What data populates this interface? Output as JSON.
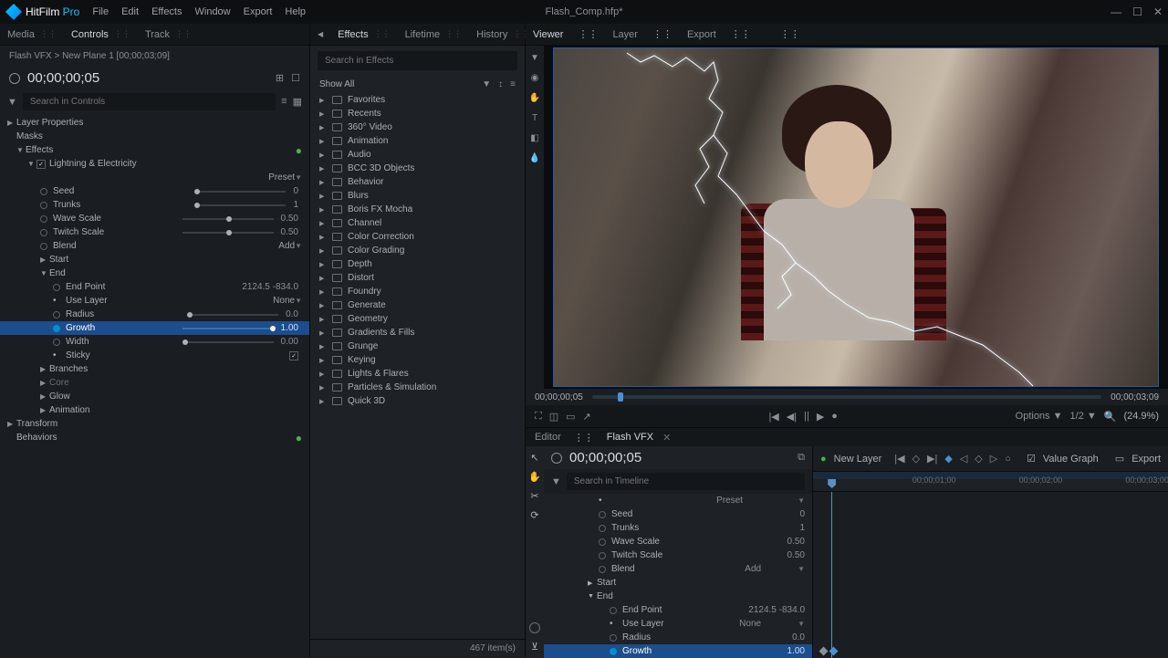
{
  "app": {
    "name": "HitFilm",
    "suffix": "Pro",
    "project": "Flash_Comp.hfp*"
  },
  "menu": [
    "File",
    "Edit",
    "Effects",
    "Window",
    "Export",
    "Help"
  ],
  "leftTabs": [
    "Media",
    "Controls",
    "Track"
  ],
  "centerTabs": [
    "Effects",
    "Lifetime",
    "History"
  ],
  "viewerTabs": [
    "Viewer",
    "Layer",
    "Export"
  ],
  "editorTabs": [
    "Editor",
    "Flash VFX"
  ],
  "breadcrumb": "Flash VFX > New Plane 1 [00;00;03;09]",
  "timecode": "00;00;00;05",
  "searchControls": "Search in Controls",
  "searchEffects": "Search in Effects",
  "searchTimeline": "Search in Timeline",
  "effectsHeader": "Show All",
  "effectsCount": "467 item(s)",
  "tree": {
    "layerProps": "Layer Properties",
    "masks": "Masks",
    "effects": "Effects",
    "lightning": "Lightning & Electricity",
    "preset": "Preset",
    "seed": "Seed",
    "seedVal": "0",
    "trunks": "Trunks",
    "trunksVal": "1",
    "waveScale": "Wave Scale",
    "waveScaleVal": "0.50",
    "twitchScale": "Twitch Scale",
    "twitchScaleVal": "0.50",
    "blend": "Blend",
    "blendVal": "Add",
    "start": "Start",
    "end": "End",
    "endPoint": "End Point",
    "endPointVal": "2124.5   -834.0",
    "useLayer": "Use Layer",
    "useLayerVal": "None",
    "radius": "Radius",
    "radiusVal": "0.0",
    "growth": "Growth",
    "growthVal": "1.00",
    "width": "Width",
    "widthVal": "0.00",
    "sticky": "Sticky",
    "branches": "Branches",
    "core": "Core",
    "glow": "Glow",
    "animation": "Animation",
    "transform": "Transform",
    "behaviors": "Behaviors"
  },
  "fxFolders": [
    "Favorites",
    "Recents",
    "360° Video",
    "Animation",
    "Audio",
    "BCC 3D Objects",
    "Behavior",
    "Blurs",
    "Boris FX Mocha",
    "Channel",
    "Color Correction",
    "Color Grading",
    "Depth",
    "Distort",
    "Foundry",
    "Generate",
    "Geometry",
    "Gradients & Fills",
    "Grunge",
    "Keying",
    "Lights & Flares",
    "Particles & Simulation",
    "Quick 3D"
  ],
  "viewer": {
    "startTime": "00;00;00;05",
    "endTime": "00;00;03;09",
    "options": "Options",
    "ratio": "1/2",
    "zoom": "(24.9%)"
  },
  "timeline": {
    "newLayer": "New Layer",
    "valueGraph": "Value Graph",
    "export": "Export",
    "ticks": [
      "00;00;01;00",
      "00;00;02;00",
      "00;00;03;00"
    ]
  }
}
